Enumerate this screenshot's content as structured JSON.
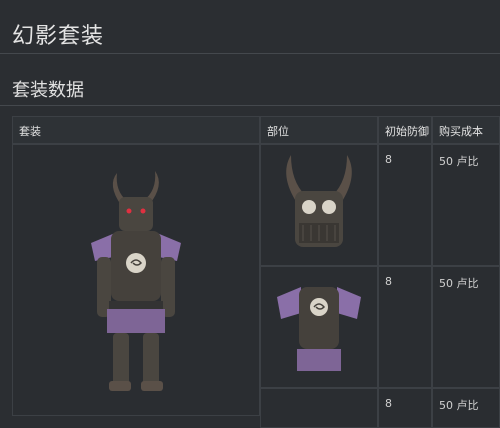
{
  "page": {
    "title": "幻影套装"
  },
  "section": {
    "title": "套装数据"
  },
  "table": {
    "headers": [
      "套装",
      "部位",
      "初始防御",
      "购买成本"
    ],
    "rows": [
      {
        "defense": "8",
        "cost": "50 卢比"
      },
      {
        "defense": "8",
        "cost": "50 卢比"
      },
      {
        "defense": "8",
        "cost": "50 卢比"
      }
    ]
  },
  "colors": {
    "background": "#2b2e32",
    "accent_purple": "#8a6fa8",
    "armor": "#4a4640"
  }
}
